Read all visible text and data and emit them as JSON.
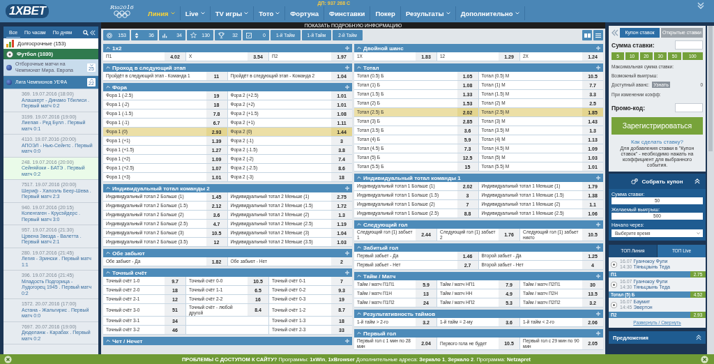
{
  "header": {
    "logo": "1XBET",
    "olympic_logo": "Rio2016",
    "jackpot": "ДП: 937 268 C",
    "nav": [
      {
        "label": "Линия",
        "selected": true,
        "dropdown": true
      },
      {
        "label": "Live",
        "selected": false,
        "dropdown": true
      },
      {
        "label": "TV игры",
        "selected": false,
        "dropdown": true
      },
      {
        "label": "Тото",
        "selected": false,
        "dropdown": true
      },
      {
        "label": "Фортуна",
        "selected": false,
        "dropdown": false
      },
      {
        "label": "Финставки",
        "selected": false,
        "dropdown": false
      },
      {
        "label": "Покер",
        "selected": false,
        "dropdown": false
      },
      {
        "label": "Результаты",
        "selected": false,
        "dropdown": true
      },
      {
        "label": "Дополнительно",
        "selected": false,
        "dropdown": true
      }
    ]
  },
  "info_bar": "ПОКАЗАТЬ ПОДРОБНУЮ ИНФОРМАЦИЮ",
  "filters": {
    "counters": [
      "153",
      "36",
      "34",
      "130",
      "32",
      "0"
    ],
    "periods": [
      "1-й Тайм",
      "1-й Тайм",
      "2-й Тайм"
    ]
  },
  "sidebar": {
    "tabs": [
      {
        "label": "Все",
        "selected": true
      },
      {
        "label": "По часам",
        "selected": false
      },
      {
        "label": "По дням",
        "selected": false
      }
    ],
    "long_term": "Долгосрочные (153)",
    "sport": "Футбол (1030)",
    "leagues": [
      {
        "name": "Отборочные матчи на Чемпионат Мира. Европа",
        "count": "25",
        "expanded": false
      },
      {
        "name": "Лига Чемпионов УЕФА",
        "count": "22",
        "expanded": true
      }
    ],
    "matches": [
      {
        "info": "369. 19.07.2016 (18:00)",
        "title": "Алашкерт - Динамо Тбилиси . Первый матч 0:2",
        "selected": false
      },
      {
        "info": "3199. 19.07.2016 (19:00)",
        "title": "Лиепая - Ред Булл . Первый матч 0:1",
        "selected": false
      },
      {
        "info": "4110. 19.07.2016 (20:00)",
        "title": "АПОЭЛ - Нью-Сейнтс . Первый матч 0:0",
        "selected": false
      },
      {
        "info": "248. 19.07.2016 (20:00)",
        "title": "Сейняйоки - БАТЭ . Первый матч 0:2",
        "selected": true
      },
      {
        "info": "7517. 19.07.2016 (20:00)",
        "title": "Шериф - Хапоэль Беер-Шева . Первый матч 2:3",
        "selected": false
      },
      {
        "info": "940. 19.07.2016 (20:15)",
        "title": "Копенгаген - Крусэйдерс . Первый матч 3:0",
        "selected": false
      },
      {
        "info": "957. 19.07.2016 (21:30)",
        "title": "Црвена Звезда - Валетта . Первый матч 2:1",
        "selected": false
      },
      {
        "info": "280. 19.07.2016 (21:45)",
        "title": "Легия - Зрински . Первый матч 1:1",
        "selected": false
      },
      {
        "info": "396. 19.07.2016 (21:45)",
        "title": "Младость Подгорица - Лудогорец 1945 . Первый матч 0:2",
        "selected": false
      },
      {
        "info": "1572. 20.07.2016 (17:00)",
        "title": "Астана - Жальгирис . Первый матч 0:0",
        "selected": false
      },
      {
        "info": "7697. 20.07.2016 (19:00)",
        "title": "Дюделанж - Карабах . Первый матч 0:2",
        "selected": false
      }
    ]
  },
  "markets": {
    "left": [
      {
        "title": "1x2",
        "rows": [
          {
            "highlighted": false,
            "cells": [
              {
                "label": "П1",
                "odds": "4.02"
              },
              {
                "label": "X",
                "odds": "3.54"
              },
              {
                "label": "П2",
                "odds": "1.97"
              }
            ]
          }
        ]
      },
      {
        "title": "Проход в следующий этап",
        "rows": [
          {
            "highlighted": false,
            "cells": [
              {
                "label": "Пройдёт в следующий этап - Команда 1",
                "odds": "11"
              },
              {
                "label": "Пройдёт в следующий этап - Команда 2",
                "odds": "1.04"
              }
            ]
          }
        ]
      },
      {
        "title": "Фора",
        "rows": [
          {
            "highlighted": false,
            "cells": [
              {
                "label": "Фора 1 (-2.5)",
                "odds": "19"
              },
              {
                "label": "Фора 2 (+2.5)",
                "odds": "1.01"
              }
            ]
          },
          {
            "highlighted": false,
            "cells": [
              {
                "label": "Фора 1 (-2)",
                "odds": "18"
              },
              {
                "label": "Фора 2 (+2)",
                "odds": "1.01"
              }
            ]
          },
          {
            "highlighted": false,
            "cells": [
              {
                "label": "Фора 1 (-1.5)",
                "odds": "7.8"
              },
              {
                "label": "Фора 2 (+1.5)",
                "odds": "1.08"
              }
            ]
          },
          {
            "highlighted": false,
            "cells": [
              {
                "label": "Фора 1 (-1)",
                "odds": "6.7"
              },
              {
                "label": "Фора 2 (+1)",
                "odds": "1.11"
              }
            ]
          },
          {
            "highlighted": true,
            "cells": [
              {
                "label": "Фора 1 (0)",
                "odds": "2.93"
              },
              {
                "label": "Фора 2 (0)",
                "odds": "1.44"
              }
            ]
          },
          {
            "highlighted": false,
            "cells": [
              {
                "label": "Фора 1 (+1)",
                "odds": "1.39"
              },
              {
                "label": "Фора 2 (-1)",
                "odds": "3"
              }
            ]
          },
          {
            "highlighted": false,
            "cells": [
              {
                "label": "Фора 1 (+1.5)",
                "odds": "1.27"
              },
              {
                "label": "Фора 2 (-1.5)",
                "odds": "3.8"
              }
            ]
          },
          {
            "highlighted": false,
            "cells": [
              {
                "label": "Фора 1 (+2)",
                "odds": "1.09"
              },
              {
                "label": "Фора 2 (-2)",
                "odds": "7.4"
              }
            ]
          },
          {
            "highlighted": false,
            "cells": [
              {
                "label": "Фора 1 (+2.5)",
                "odds": "1.07"
              },
              {
                "label": "Фора 2 (-2.5)",
                "odds": "8.6"
              }
            ]
          },
          {
            "highlighted": false,
            "cells": [
              {
                "label": "Фора 1 (+3)",
                "odds": "1.01"
              },
              {
                "label": "Фора 2 (-3)",
                "odds": "18"
              }
            ]
          }
        ]
      },
      {
        "title": "Индивидуальный тотал команды 2",
        "rows": [
          {
            "highlighted": false,
            "cells": [
              {
                "label": "Индивидуальный тотал 2 Больше (1)",
                "odds": "1.45"
              },
              {
                "label": "Индивидуальный тотал 2 Меньше (1)",
                "odds": "2.75"
              }
            ]
          },
          {
            "highlighted": false,
            "cells": [
              {
                "label": "Индивидуальный тотал 2 Больше (1.5)",
                "odds": "2.12"
              },
              {
                "label": "Индивидуальный тотал 2 Меньше (1.5)",
                "odds": "1.72"
              }
            ]
          },
          {
            "highlighted": false,
            "cells": [
              {
                "label": "Индивидуальный тотал 2 Больше (2)",
                "odds": "3.6"
              },
              {
                "label": "Индивидуальный тотал 2 Меньше (2)",
                "odds": "1.3"
              }
            ]
          },
          {
            "highlighted": false,
            "cells": [
              {
                "label": "Индивидуальный тотал 2 Больше (2.5)",
                "odds": "4.7"
              },
              {
                "label": "Индивидуальный тотал 2 Меньше (2.5)",
                "odds": "1.19"
              }
            ]
          },
          {
            "highlighted": false,
            "cells": [
              {
                "label": "Индивидуальный тотал 2 Больше (3)",
                "odds": "10.5"
              },
              {
                "label": "Индивидуальный тотал 2 Меньше (3)",
                "odds": "1.04"
              }
            ]
          },
          {
            "highlighted": false,
            "cells": [
              {
                "label": "Индивидуальный тотал 2 Больше (3.5)",
                "odds": "12"
              },
              {
                "label": "Индивидуальный тотал 2 Меньше (3.5)",
                "odds": "1.03"
              }
            ]
          }
        ]
      },
      {
        "title": "Обе забьют",
        "rows": [
          {
            "highlighted": false,
            "cells": [
              {
                "label": "Обе забьют - Да",
                "odds": "1.82"
              },
              {
                "label": "Обе забьют - Нет",
                "odds": "2"
              }
            ]
          }
        ]
      },
      {
        "title": "Точный счёт",
        "rows": [
          {
            "highlighted": false,
            "cells": [
              {
                "label": "Точный счёт 1-0",
                "odds": "9.7"
              },
              {
                "label": "Точный счёт 0-0",
                "odds": "10.5"
              },
              {
                "label": "Точный счёт 0-1",
                "odds": "7"
              }
            ]
          },
          {
            "highlighted": false,
            "cells": [
              {
                "label": "Точный счёт 2-0",
                "odds": "18"
              },
              {
                "label": "Точный счёт 1-1",
                "odds": "6.5"
              },
              {
                "label": "Точный счёт 0-2",
                "odds": "9.3"
              }
            ]
          },
          {
            "highlighted": false,
            "cells": [
              {
                "label": "Точный счёт 2-1",
                "odds": "12"
              },
              {
                "label": "Точный счёт 2-2",
                "odds": "16"
              },
              {
                "label": "Точный счёт 0-3",
                "odds": "19"
              }
            ]
          },
          {
            "highlighted": false,
            "cells": [
              {
                "label": "Точный счёт 3-0",
                "odds": "51"
              },
              {
                "label": "Точный счёт - любой другой",
                "odds": "8.4"
              },
              {
                "label": "Точный счёт 1-2",
                "odds": "8.7"
              }
            ]
          },
          {
            "highlighted": false,
            "cells": [
              {
                "label": "Точный счёт 3-1",
                "odds": "34"
              },
              {},
              {
                "label": "Точный счёт 1-3",
                "odds": "18"
              }
            ]
          },
          {
            "highlighted": false,
            "cells": [
              {
                "label": "Точный счёт 3-2",
                "odds": "46"
              },
              {},
              {
                "label": "Точный счёт 2-3",
                "odds": "33"
              }
            ]
          }
        ]
      },
      {
        "title": "Чет / Нечет"
      }
    ],
    "right": [
      {
        "title": "Двойной шанс",
        "rows": [
          {
            "highlighted": false,
            "cells": [
              {
                "label": "1X",
                "odds": "1.83"
              },
              {
                "label": "12",
                "odds": "1.29"
              },
              {
                "label": "2X",
                "odds": "1.24"
              }
            ]
          }
        ]
      },
      {
        "title": "Тотал",
        "rows": [
          {
            "highlighted": false,
            "cells": [
              {
                "label": "Тотал (0.5) Б",
                "odds": "1.05"
              },
              {
                "label": "Тотал (0.5) М",
                "odds": "10.5"
              }
            ]
          },
          {
            "highlighted": false,
            "cells": [
              {
                "label": "Тотал (1) Б",
                "odds": "1.08"
              },
              {
                "label": "Тотал (1) М",
                "odds": "7.7"
              }
            ]
          },
          {
            "highlighted": false,
            "cells": [
              {
                "label": "Тотал (1.5) Б",
                "odds": "1.33"
              },
              {
                "label": "Тотал (1.5) М",
                "odds": "3.3"
              }
            ]
          },
          {
            "highlighted": false,
            "cells": [
              {
                "label": "Тотал (2) Б",
                "odds": "1.53"
              },
              {
                "label": "Тотал (2) М",
                "odds": "2.5"
              }
            ]
          },
          {
            "highlighted": true,
            "cells": [
              {
                "label": "Тотал (2.5) Б",
                "odds": "2.02"
              },
              {
                "label": "Тотал (2.5) М",
                "odds": "1.85"
              }
            ]
          },
          {
            "highlighted": false,
            "cells": [
              {
                "label": "Тотал (3) Б",
                "odds": "2.85"
              },
              {
                "label": "Тотал (3) М",
                "odds": "1.43"
              }
            ]
          },
          {
            "highlighted": false,
            "cells": [
              {
                "label": "Тотал (3.5) Б",
                "odds": "3.6"
              },
              {
                "label": "Тотал (3.5) М",
                "odds": "1.3"
              }
            ]
          },
          {
            "highlighted": false,
            "cells": [
              {
                "label": "Тотал (4) Б",
                "odds": "5.9"
              },
              {
                "label": "Тотал (4) М",
                "odds": "1.13"
              }
            ]
          },
          {
            "highlighted": false,
            "cells": [
              {
                "label": "Тотал (4.5) Б",
                "odds": "7.3"
              },
              {
                "label": "Тотал (4.5) М",
                "odds": "1.09"
              }
            ]
          },
          {
            "highlighted": false,
            "cells": [
              {
                "label": "Тотал (5) Б",
                "odds": "12.5"
              },
              {
                "label": "Тотал (5) М",
                "odds": "1.03"
              }
            ]
          },
          {
            "highlighted": false,
            "cells": [
              {
                "label": "Тотал (5.5) Б",
                "odds": "15"
              },
              {
                "label": "Тотал (5.5) М",
                "odds": "1.01"
              }
            ]
          }
        ]
      },
      {
        "title": "Индивидуальный тотал команды 1",
        "rows": [
          {
            "highlighted": false,
            "cells": [
              {
                "label": "Индивидуальный тотал 1 Больше (1)",
                "odds": "2.02"
              },
              {
                "label": "Индивидуальный тотал 1 Меньше (1)",
                "odds": "1.79"
              }
            ]
          },
          {
            "highlighted": false,
            "cells": [
              {
                "label": "Индивидуальный тотал 1 Больше (1.5)",
                "odds": "3"
              },
              {
                "label": "Индивидуальный тотал 1 Меньше (1.5)",
                "odds": "1.38"
              }
            ]
          },
          {
            "highlighted": false,
            "cells": [
              {
                "label": "Индивидуальный тотал 1 Больше (2)",
                "odds": "7"
              },
              {
                "label": "Индивидуальный тотал 1 Меньше (2)",
                "odds": "1.1"
              }
            ]
          },
          {
            "highlighted": false,
            "cells": [
              {
                "label": "Индивидуальный тотал 1 Больше (2.5)",
                "odds": "8.8"
              },
              {
                "label": "Индивидуальный тотал 1 Меньше (2.5)",
                "odds": "1.06"
              }
            ]
          }
        ]
      },
      {
        "title": "Следующий гол",
        "rows": [
          {
            "highlighted": false,
            "cells": [
              {
                "label": "Следующий гол (1) забьет 1",
                "odds": "2.44"
              },
              {
                "label": "Следующий гол (1) забьет 2",
                "odds": "1.76"
              },
              {
                "label": "Следующий гол (1) забьет никто",
                "odds": "10.5"
              }
            ]
          }
        ]
      },
      {
        "title": "Забитый гол",
        "rows": [
          {
            "highlighted": false,
            "cells": [
              {
                "label": "Первый забьет - Да",
                "odds": "1.46"
              },
              {
                "label": "Второй забьет - Да",
                "odds": "1.25"
              }
            ]
          },
          {
            "highlighted": false,
            "cells": [
              {
                "label": "Первый забьет - Нет",
                "odds": "2.7"
              },
              {
                "label": "Второй забьет - Нет",
                "odds": "4"
              }
            ]
          }
        ]
      },
      {
        "title": "Тайм / Матч",
        "rows": [
          {
            "highlighted": false,
            "cells": [
              {
                "label": "Тайм / матч П1П1",
                "odds": "5.9"
              },
              {
                "label": "Тайм / матч НП1",
                "odds": "7.9"
              },
              {
                "label": "Тайм / матч П2П1",
                "odds": "30"
              }
            ]
          },
          {
            "highlighted": false,
            "cells": [
              {
                "label": "Тайм / матч П1Н",
                "odds": "13"
              },
              {
                "label": "Тайм / матч НН",
                "odds": "4.9"
              },
              {
                "label": "Тайм / матч П2Н",
                "odds": "13.5"
              }
            ]
          },
          {
            "highlighted": false,
            "cells": [
              {
                "label": "Тайм / матч П1П2",
                "odds": "24"
              },
              {
                "label": "Тайм / матч НП2",
                "odds": "5.3"
              },
              {
                "label": "Тайм / матч П2П2",
                "odds": "3.2"
              }
            ]
          }
        ]
      },
      {
        "title": "Результативность таймов",
        "rows": [
          {
            "highlighted": false,
            "cells": [
              {
                "label": "1-й тайм > 2-го",
                "odds": "3.2"
              },
              {
                "label": "1-й тайм = 2-му",
                "odds": "3.6"
              },
              {
                "label": "1-й тайм < 2-го",
                "odds": "2.06"
              }
            ]
          }
        ]
      },
      {
        "title": "Первый гол",
        "rows": [
          {
            "highlighted": false,
            "cells": [
              {
                "label": "Первый гол с 1 мин по 28 мин",
                "odds": "2.04"
              },
              {
                "label": "Первого гола не будет",
                "odds": "10.5"
              },
              {
                "label": "Первый гол с 29 мин по 90 мин",
                "odds": "2.05"
              }
            ]
          }
        ]
      }
    ]
  },
  "coupon": {
    "tabs": [
      {
        "label": "Купон ставок",
        "selected": true
      },
      {
        "label": "Открытые ставки",
        "selected": false
      }
    ],
    "stake_label": "Сумма ставки:",
    "amounts": [
      "5",
      "10",
      "20",
      "30",
      "50",
      "100"
    ],
    "info": [
      "Максимальная сумма ставки:",
      "Возможный выигрыш:"
    ],
    "advance": {
      "label": "Доступный аванс:",
      "button": "Узнать",
      "value": "0"
    },
    "odds_change": "При изменении коэфф:",
    "promo_label": "Промо-код:",
    "register": "Зарегистрироваться",
    "help_link": "Как сделать ставку?",
    "help_text": "Для добавления ставки в \"Купон ставок\" - необходимо нажать на коэффициент для выбранного события."
  },
  "collector": {
    "title": "Собрать купон",
    "stake_label": "Сумма ставки:",
    "stake_value": "50",
    "win_label": "Желаемый выигрыш:",
    "win_value": "500",
    "start_label": "Начало через:",
    "start_value": "Выберите время"
  },
  "top": {
    "tabs": [
      {
        "label": "ТОП Линия",
        "selected": true
      },
      {
        "label": "ТОП Live",
        "selected": false
      }
    ],
    "events": [
      {
        "date": "16.07",
        "time": "14:30",
        "team1": "Гуанчжоу Фули",
        "team2": "Тяньцзынь Теда",
        "bet": "П1",
        "odds": "2.75"
      },
      {
        "date": "16.07",
        "time": "14:30",
        "team1": "Гуанчжоу Фули",
        "team2": "Тяньцзынь Теда",
        "bet": "Тотал (5) Б",
        "odds": "4.52"
      },
      {
        "date": "16.07",
        "time": "14:45",
        "team1": "Баумит",
        "team2": "Эвертон",
        "bet": "П2",
        "odds": "2.93"
      }
    ],
    "toggle": "Развернуть / Свернуть"
  },
  "offers": {
    "title": "Предложения"
  },
  "banner": "**ПРОБЛЕМЫ С ДОСТУПОМ К САЙТУ?** Программы: **1xWin**, **1xBrowser** Дополнительные адреса: **Зеркало 1**, **Зеркало 2**. Программа: **Netzapret**"
}
